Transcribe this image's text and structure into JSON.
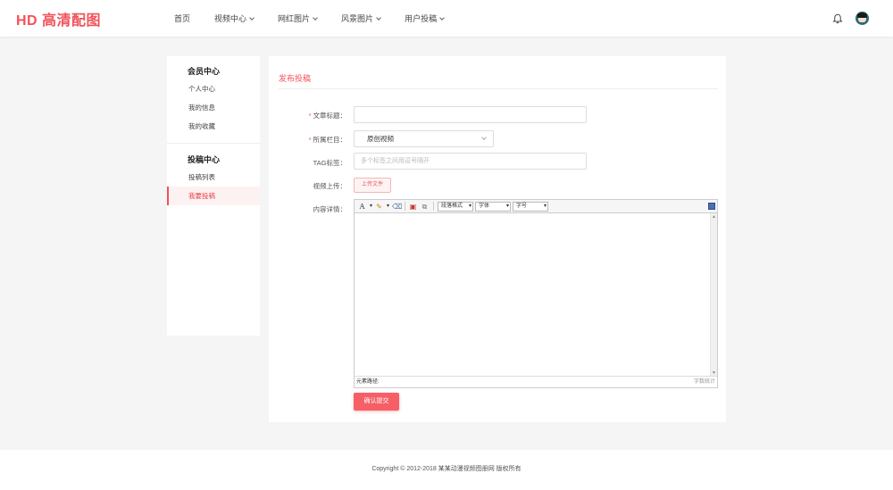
{
  "header": {
    "logo": "HD 高清配图",
    "nav": [
      {
        "label": "首页",
        "has_dropdown": false
      },
      {
        "label": "视频中心",
        "has_dropdown": true
      },
      {
        "label": "网红图片",
        "has_dropdown": true
      },
      {
        "label": "风景图片",
        "has_dropdown": true
      },
      {
        "label": "用户投稿",
        "has_dropdown": true
      }
    ],
    "icons": {
      "notification": "bell-icon",
      "user": "avatar"
    }
  },
  "sidebar": {
    "group1": {
      "title": "会员中心",
      "items": [
        "个人中心",
        "我的信息",
        "我的收藏"
      ]
    },
    "group2": {
      "title": "投稿中心",
      "items": [
        "投稿列表",
        "我要投稿"
      ],
      "active_index": 1
    }
  },
  "form": {
    "section_title": "发布投稿",
    "fields": {
      "title_label": "文章标题：",
      "title_value": "",
      "category_label": "所属栏目：",
      "category_value": "原创视频",
      "tag_label": "TAG标签：",
      "tag_placeholder": "多个标签之间用逗号隔开",
      "upload_label": "视频上传：",
      "upload_button": "上传文件",
      "content_label": "内容详情："
    },
    "required_mark": "*",
    "editor": {
      "toolbar": {
        "font_color": "A",
        "paragraph": "段落格式",
        "font_family": "字体",
        "font_size": "字号"
      },
      "status_path": "元素路径:",
      "word_count": "字数统计"
    },
    "submit_button": "确认提交"
  },
  "footer": {
    "copyright": "Copyright © 2012-2018 某某动漫视频图册网 版权所有"
  },
  "colors": {
    "accent": "#f2525a",
    "button": "#f65f66",
    "background": "#f5f5f5"
  }
}
